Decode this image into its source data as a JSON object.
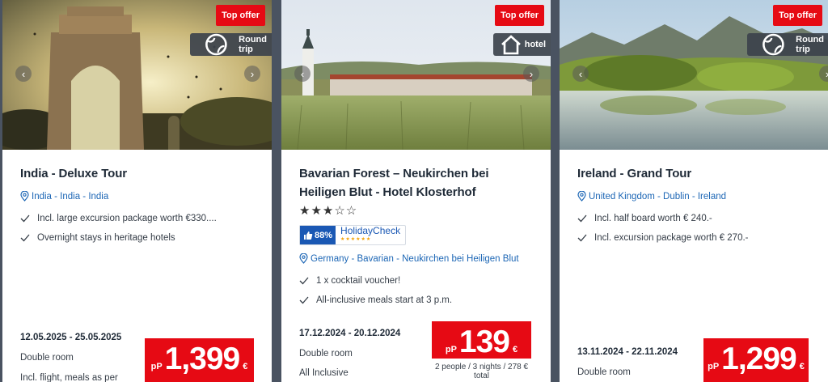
{
  "cards": [
    {
      "badge": "Top offer",
      "type_label": "Round trip",
      "type_icon": "globe-icon",
      "title": "India - Deluxe Tour",
      "location": "India - India - India",
      "features": [
        "Incl. large excursion package worth €330....",
        "Overnight stays in heritage hotels"
      ],
      "dates": "12.05.2025 - 25.05.2025",
      "room": "Double room",
      "board": "Incl. flight, meals as per",
      "price_prefix": "pP",
      "price": "1,399",
      "currency": "€"
    },
    {
      "badge": "Top offer",
      "type_label": "hotel",
      "type_icon": "house-icon",
      "title": "Bavarian Forest – Neukirchen bei Heiligen Blut - Hotel Klosterhof",
      "stars": "★★★☆☆",
      "rating_pct": "88%",
      "rating_brand": "HolidayCheck",
      "rating_stars": "★★★★★★",
      "location": "Germany - Bavarian - Neukirchen bei Heiligen Blut",
      "features": [
        "1 x cocktail voucher!",
        "All-inclusive meals start at 3 p.m."
      ],
      "dates": "17.12.2024 - 20.12.2024",
      "room": "Double room",
      "board": "All Inclusive",
      "price_prefix": "pP",
      "price": "139",
      "currency": "€",
      "total": "2 people / 3 nights / 278 € total"
    },
    {
      "badge": "Top offer",
      "type_label": "Round trip",
      "type_icon": "globe-icon",
      "title": "Ireland - Grand Tour",
      "location": "United Kingdom - Dublin - Ireland",
      "features": [
        "Incl. half board worth € 240.-",
        "Incl. excursion package worth € 270.-"
      ],
      "dates": "13.11.2024 - 22.11.2024",
      "room": "Double room",
      "price_prefix": "pP",
      "price": "1,299",
      "currency": "€"
    }
  ],
  "colors": {
    "accent": "#e60a14",
    "link": "#1c66b5",
    "background": "#4a5361"
  }
}
